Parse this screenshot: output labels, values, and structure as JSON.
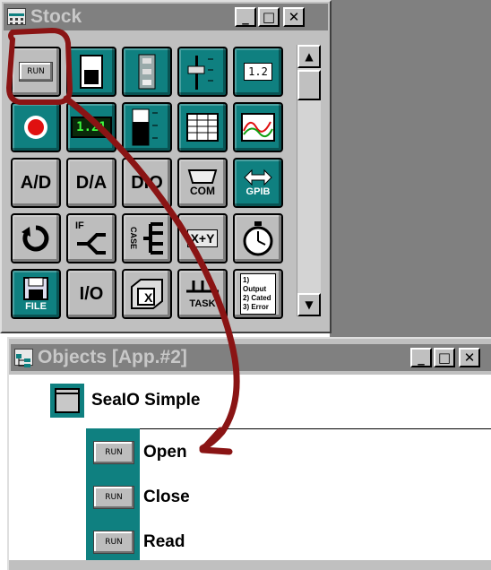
{
  "stock_window": {
    "title": "Stock",
    "buttons": {
      "minimize": "_",
      "maximize": "□",
      "close": "✕"
    },
    "tiles": [
      {
        "label": "RUN",
        "icon": "run-button-icon",
        "style": "gray"
      },
      {
        "label": "",
        "icon": "toggle-switch-icon",
        "style": "teal"
      },
      {
        "label": "",
        "icon": "multi-switch-icon",
        "style": "teal"
      },
      {
        "label": "",
        "icon": "slider-icon",
        "style": "teal"
      },
      {
        "label": "1.2",
        "icon": "numeric-input-icon",
        "style": "teal"
      },
      {
        "label": "",
        "icon": "led-indicator-icon",
        "style": "teal"
      },
      {
        "label": "1.21",
        "icon": "digital-display-icon",
        "style": "teal"
      },
      {
        "label": "",
        "icon": "bar-meter-icon",
        "style": "teal"
      },
      {
        "label": "",
        "icon": "table-icon",
        "style": "teal"
      },
      {
        "label": "",
        "icon": "graph-icon",
        "style": "teal"
      },
      {
        "label": "A/D",
        "icon": "analog-digital-icon",
        "style": "gray"
      },
      {
        "label": "D/A",
        "icon": "digital-analog-icon",
        "style": "gray"
      },
      {
        "label": "DIO",
        "icon": "digital-io-icon",
        "style": "gray"
      },
      {
        "label": "COM",
        "icon": "serial-com-icon",
        "style": "gray"
      },
      {
        "label": "GPIB",
        "icon": "gpib-icon",
        "style": "teal"
      },
      {
        "label": "",
        "icon": "loop-icon",
        "style": "gray"
      },
      {
        "label": "IF",
        "icon": "if-branch-icon",
        "style": "gray"
      },
      {
        "label": "CASE",
        "icon": "case-icon",
        "style": "gray"
      },
      {
        "label": "X+Y",
        "icon": "formula-icon",
        "style": "gray"
      },
      {
        "label": "",
        "icon": "timer-icon",
        "style": "gray"
      },
      {
        "label": "FILE",
        "icon": "file-icon",
        "style": "teal"
      },
      {
        "label": "I/O",
        "icon": "io-icon",
        "style": "gray"
      },
      {
        "label": "X",
        "icon": "variable-box-icon",
        "style": "gray"
      },
      {
        "label": "TASK",
        "icon": "task-icon",
        "style": "gray"
      },
      {
        "label": "1) Output 2) Cated 3) Error",
        "icon": "sequence-list-icon",
        "style": "gray"
      }
    ]
  },
  "objects_window": {
    "title": "Objects [App.#2]",
    "buttons": {
      "minimize": "_",
      "maximize": "□",
      "close": "✕"
    },
    "root": {
      "label": "SeaIO Simple",
      "icon": "window-icon"
    },
    "items": [
      {
        "badge": "RUN",
        "label": "Open"
      },
      {
        "badge": "RUN",
        "label": "Close"
      },
      {
        "badge": "RUN",
        "label": "Read"
      }
    ]
  },
  "colors": {
    "tile_teal": "#0f8080",
    "tile_gray": "#bdbdbd",
    "annotation": "#8a1414",
    "titlebar": "#808080"
  }
}
